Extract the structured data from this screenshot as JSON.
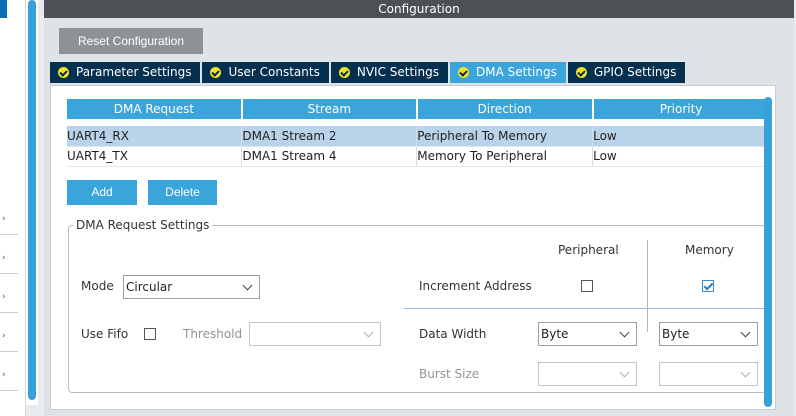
{
  "panel": {
    "title": "Configuration"
  },
  "toolbar": {
    "reset_label": "Reset Configuration"
  },
  "tabs": [
    {
      "label": "Parameter Settings",
      "active": false
    },
    {
      "label": "User Constants",
      "active": false
    },
    {
      "label": "NVIC Settings",
      "active": false
    },
    {
      "label": "DMA Settings",
      "active": true
    },
    {
      "label": "GPIO Settings",
      "active": false
    }
  ],
  "table": {
    "headers": [
      "DMA Request",
      "Stream",
      "Direction",
      "Priority"
    ],
    "rows": [
      {
        "request": "UART4_RX",
        "stream": "DMA1 Stream 2",
        "direction": "Peripheral To Memory",
        "priority": "Low",
        "selected": true
      },
      {
        "request": "UART4_TX",
        "stream": "DMA1 Stream 4",
        "direction": "Memory To Peripheral",
        "priority": "Low",
        "selected": false
      }
    ]
  },
  "actions": {
    "add_label": "Add",
    "delete_label": "Delete"
  },
  "settings": {
    "legend": "DMA Request Settings",
    "peripheral_header": "Peripheral",
    "memory_header": "Memory",
    "mode_label": "Mode",
    "mode_value": "Circular",
    "increment_label": "Increment Address",
    "increment_peripheral": false,
    "increment_memory": true,
    "use_fifo_label": "Use Fifo",
    "use_fifo": false,
    "threshold_label": "Threshold",
    "threshold_value": "",
    "data_width_label": "Data Width",
    "data_width_peripheral": "Byte",
    "data_width_memory": "Byte",
    "burst_size_label": "Burst Size",
    "burst_peripheral": "",
    "burst_memory": ""
  },
  "colors": {
    "accent": "#3aa5db",
    "tab_dark": "#06304f",
    "title_bar": "#4d5156",
    "selected_row": "#b9d4ea"
  }
}
